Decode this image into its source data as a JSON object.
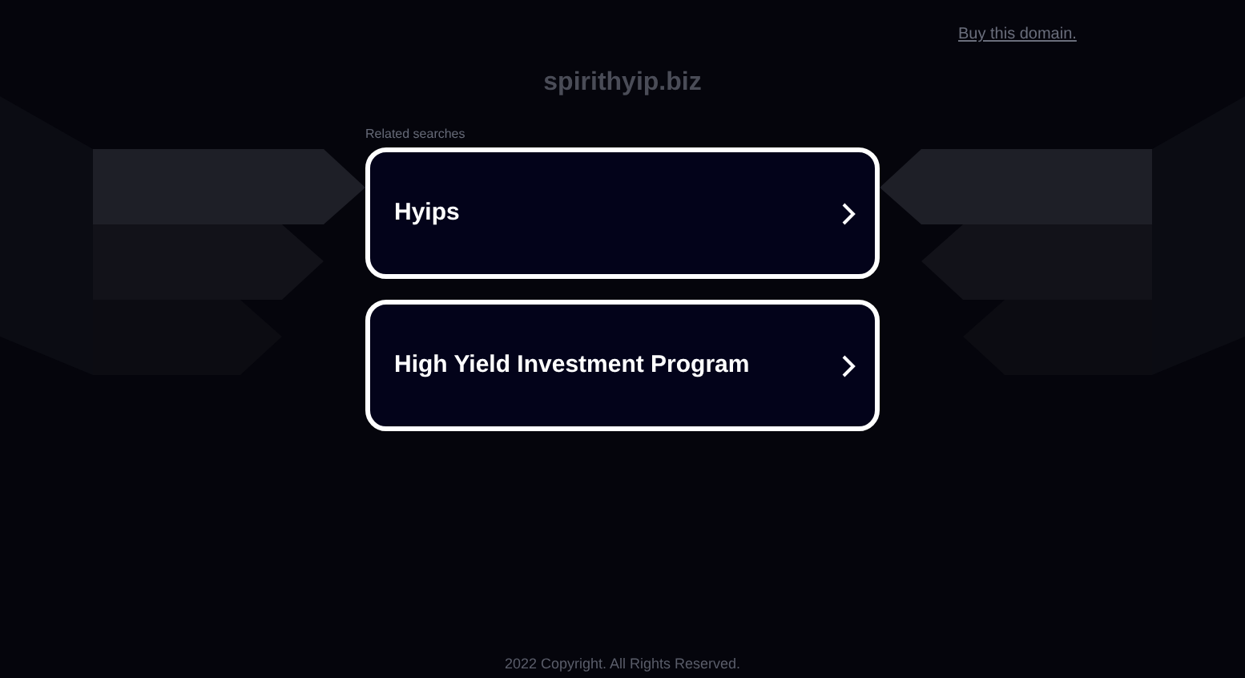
{
  "top_link": "Buy this domain.",
  "domain": "spirithyip.biz",
  "related_label": "Related searches",
  "searches": [
    {
      "label": "Hyips"
    },
    {
      "label": "High Yield Investment Program"
    }
  ],
  "footer": "2022 Copyright. All Rights Reserved."
}
